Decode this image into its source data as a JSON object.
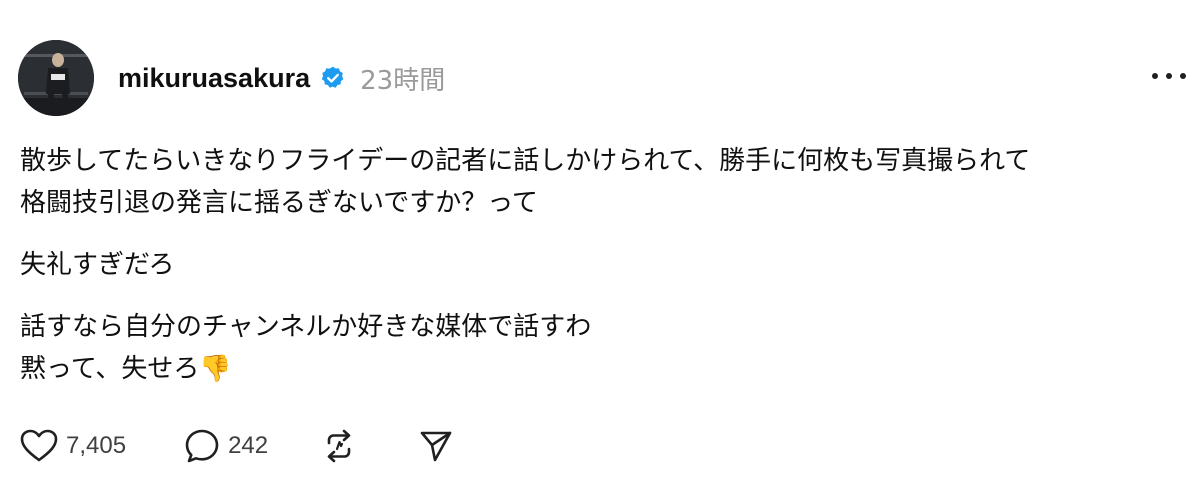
{
  "post": {
    "username": "mikuruasakura",
    "timestamp": "23時間",
    "paragraphs": [
      [
        "散歩してたらいきなりフライデーの記者に話しかけられて、勝手に何枚も写真撮られて",
        "格闘技引退の発言に揺るぎないですか？って"
      ],
      [
        "失礼すぎだろ"
      ],
      [
        "話すなら自分のチャンネルか好きな媒体で話すわ",
        "黙って、失せろ👎"
      ]
    ],
    "likes": "7,405",
    "replies": "242"
  },
  "icons": {
    "verified": "verified-badge-icon",
    "more": "more-options-icon",
    "like": "heart-icon",
    "reply": "comment-bubble-icon",
    "repost": "repost-icon",
    "share": "send-icon"
  },
  "colors": {
    "verified": "#1d9bf0",
    "muted": "#9a9a9a",
    "text": "#101010"
  }
}
